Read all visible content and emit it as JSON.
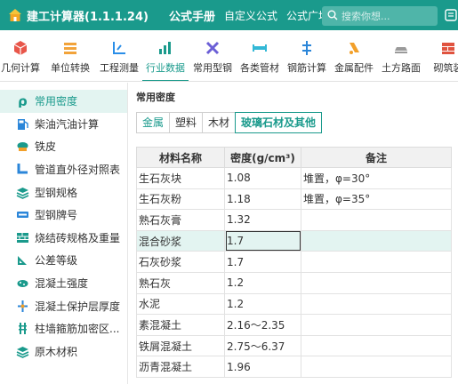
{
  "app": {
    "title": "建工计算器(1.1.1.24)"
  },
  "top_tabs": [
    "公式手册",
    "自定义公式",
    "公式广场"
  ],
  "search": {
    "placeholder": "搜索你想..."
  },
  "toolbar": [
    "几何计算",
    "单位转换",
    "工程测量",
    "行业数据",
    "常用型钢",
    "各类管材",
    "钢筋计算",
    "金属配件",
    "土方路面",
    "砌筑装"
  ],
  "toolbar_active": "行业数据",
  "sidebar": [
    {
      "label": "常用密度",
      "icon": "rho-icon"
    },
    {
      "label": "柴油汽油计算",
      "icon": "fuel-pump-icon"
    },
    {
      "label": "铁皮",
      "icon": "iron-sheet-icon"
    },
    {
      "label": "管道直外径对照表",
      "icon": "pipe-icon"
    },
    {
      "label": "型钢规格",
      "icon": "steel-stack-icon"
    },
    {
      "label": "型钢牌号",
      "icon": "steel-grade-icon"
    },
    {
      "label": "烧结砖规格及重量",
      "icon": "brick-icon"
    },
    {
      "label": "公差等级",
      "icon": "ruler-icon"
    },
    {
      "label": "混凝土强度",
      "icon": "concrete-icon"
    },
    {
      "label": "混凝土保护层厚度",
      "icon": "rebar-cover-icon"
    },
    {
      "label": "柱墙箍筋加密区...",
      "icon": "column-icon"
    },
    {
      "label": "原木材积",
      "icon": "log-icon"
    }
  ],
  "main": {
    "section_title": "常用密度",
    "tabs": [
      "金属",
      "塑料",
      "木材",
      "玻璃石材及其他"
    ],
    "active_tab": "玻璃石材及其他",
    "columns": [
      "材料名称",
      "密度(g/cm³)",
      "备注"
    ],
    "rows": [
      [
        "生石灰块",
        "1.08",
        "堆置，φ=30°"
      ],
      [
        "生石灰粉",
        "1.18",
        "堆置，φ=35°"
      ],
      [
        "熟石灰膏",
        "1.32",
        ""
      ],
      [
        "混合砂浆",
        "1.7",
        ""
      ],
      [
        "石灰砂浆",
        "1.7",
        ""
      ],
      [
        "熟石灰",
        "1.2",
        ""
      ],
      [
        "水泥",
        "1.2",
        ""
      ],
      [
        "素混凝土",
        "2.16～2.35",
        ""
      ],
      [
        "铁屑混凝土",
        "2.75～6.37",
        ""
      ],
      [
        "沥青混凝土",
        "1.96",
        ""
      ]
    ],
    "selected_row": 3
  },
  "colors": {
    "brand": "#1a9a8c",
    "selected_row": "#e3f4f1"
  }
}
